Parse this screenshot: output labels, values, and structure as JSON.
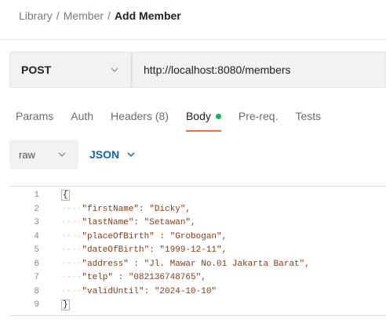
{
  "breadcrumb": {
    "items": [
      "Library",
      "Member"
    ],
    "separator": "/",
    "current": "Add Member"
  },
  "request": {
    "method": "POST",
    "url": "http://localhost:8080/members"
  },
  "tabs": {
    "params": "Params",
    "auth": "Auth",
    "headers": "Headers (8)",
    "body": "Body",
    "prereq": "Pre-req.",
    "tests": "Tests",
    "active": "Body",
    "body_dot_color": "#0cbb52",
    "active_underline_color": "#f26b3a"
  },
  "body_options": {
    "mode": "raw",
    "language": "JSON",
    "language_color": "#0b63c5"
  },
  "editor": {
    "lines": [
      {
        "n": "1",
        "indent": "",
        "text": "{"
      },
      {
        "n": "2",
        "indent": "····",
        "text": "\"firstName\": \"Dicky\","
      },
      {
        "n": "3",
        "indent": "····",
        "text": "\"lastName\": \"Setawan\","
      },
      {
        "n": "4",
        "indent": "····",
        "text": "\"placeOfBirth\" : \"Grobogan\","
      },
      {
        "n": "5",
        "indent": "····",
        "text": "\"dateOfBirth\": \"1999-12-11\","
      },
      {
        "n": "6",
        "indent": "····",
        "text": "\"address\" : \"Jl. Mawar No.01 Jakarta Barat\","
      },
      {
        "n": "7",
        "indent": "····",
        "text": "\"telp\" : \"082136748765\","
      },
      {
        "n": "8",
        "indent": "····",
        "text": "\"validUntil\": \"2024-10-10\""
      },
      {
        "n": "9",
        "indent": "",
        "text": "}"
      }
    ]
  }
}
